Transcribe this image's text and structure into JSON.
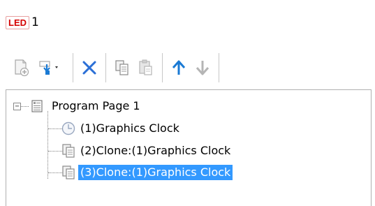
{
  "header": {
    "badge": "LED",
    "number": "1"
  },
  "toolbar": {
    "buttons": [
      {
        "name": "add-page-icon"
      },
      {
        "name": "add-item-dropdown-icon"
      },
      {
        "name": "delete-icon"
      },
      {
        "name": "copy-icon"
      },
      {
        "name": "paste-icon"
      },
      {
        "name": "move-up-icon"
      },
      {
        "name": "move-down-icon"
      }
    ],
    "colors": {
      "accent": "#1a7ad4",
      "disabled": "#b5b5b5",
      "delete": "#2b6fd6"
    }
  },
  "tree": {
    "root": {
      "label": "Program Page 1",
      "expanded": true
    },
    "children": [
      {
        "label": "(1)Graphics Clock",
        "icon": "clock-icon"
      },
      {
        "label": "(2)Clone:(1)Graphics Clock",
        "icon": "clone-icon"
      },
      {
        "label": "(3)Clone:(1)Graphics Clock",
        "icon": "clone-icon",
        "selected": true
      }
    ],
    "selection_color": "#3399ff"
  }
}
